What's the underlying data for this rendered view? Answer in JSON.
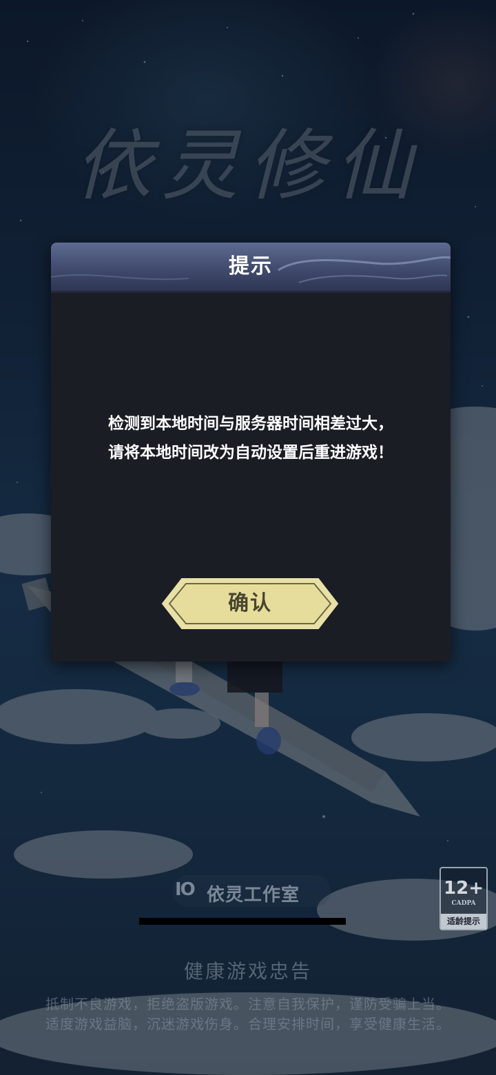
{
  "background": {
    "game_title": "依灵修仙"
  },
  "dialog": {
    "title": "提示",
    "message_line1": "检测到本地时间与服务器时间相差过大，",
    "message_line2": "请将本地时间改为自动设置后重进游戏！",
    "confirm_label": "确认"
  },
  "footer": {
    "studio_logo": "IO",
    "studio_name": "依灵工作室",
    "age_rating": "12+",
    "age_org": "CADPA",
    "age_label": "适龄提示",
    "health_title": "健康游戏忠告",
    "health_line1": "抵制不良游戏，拒绝盗版游戏。注意自我保护，谨防受骗上当。",
    "health_line2": "适度游戏益脑，沉迷游戏伤身。合理安排时间，享受健康生活。"
  },
  "colors": {
    "dialog_bg": "#1a1d24",
    "header_bg": "#424d70",
    "button_fill": "#e6dd9c",
    "button_text": "#4a4530"
  },
  "icons": {
    "confirm_shape": "hexagon-button"
  }
}
